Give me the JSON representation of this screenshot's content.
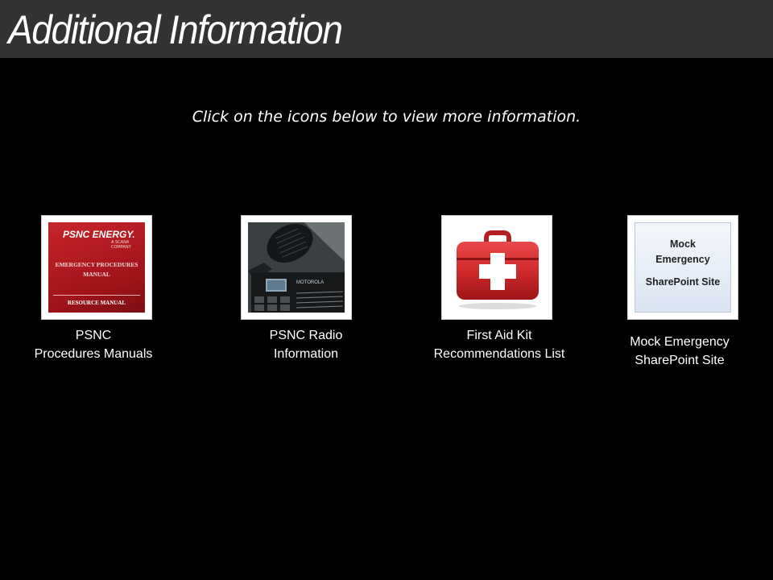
{
  "header": {
    "title": "Additional Information"
  },
  "instructions": "Click on the icons below to view more information.",
  "links": [
    {
      "icon": "procedures-manual-icon",
      "caption_line1": "PSNC",
      "caption_line2": "Procedures Manuals",
      "image_text": {
        "brand": "PSNC ENERGY.",
        "brand_sub": "A SCANA COMPANY",
        "line1": "EMERGENCY PROCEDURES",
        "line2": "MANUAL",
        "line3": "RESOURCE MANUAL"
      }
    },
    {
      "icon": "radio-icon",
      "caption_line1": "PSNC Radio",
      "caption_line2": "Information",
      "image_text": {
        "brand": "MOTOROLA"
      }
    },
    {
      "icon": "first-aid-kit-icon",
      "caption_line1": "First Aid Kit",
      "caption_line2": "Recommendations List"
    },
    {
      "icon": "sharepoint-site-icon",
      "caption_line1": "Mock Emergency",
      "caption_line2": "SharePoint Site",
      "image_text": {
        "line1": "Mock",
        "line2": "Emergency",
        "line3": "SharePoint Site"
      }
    }
  ],
  "colors": {
    "background": "#000000",
    "title_bar": "#333333",
    "manual_red": "#b31b21",
    "first_aid_red": "#d22a2c"
  }
}
